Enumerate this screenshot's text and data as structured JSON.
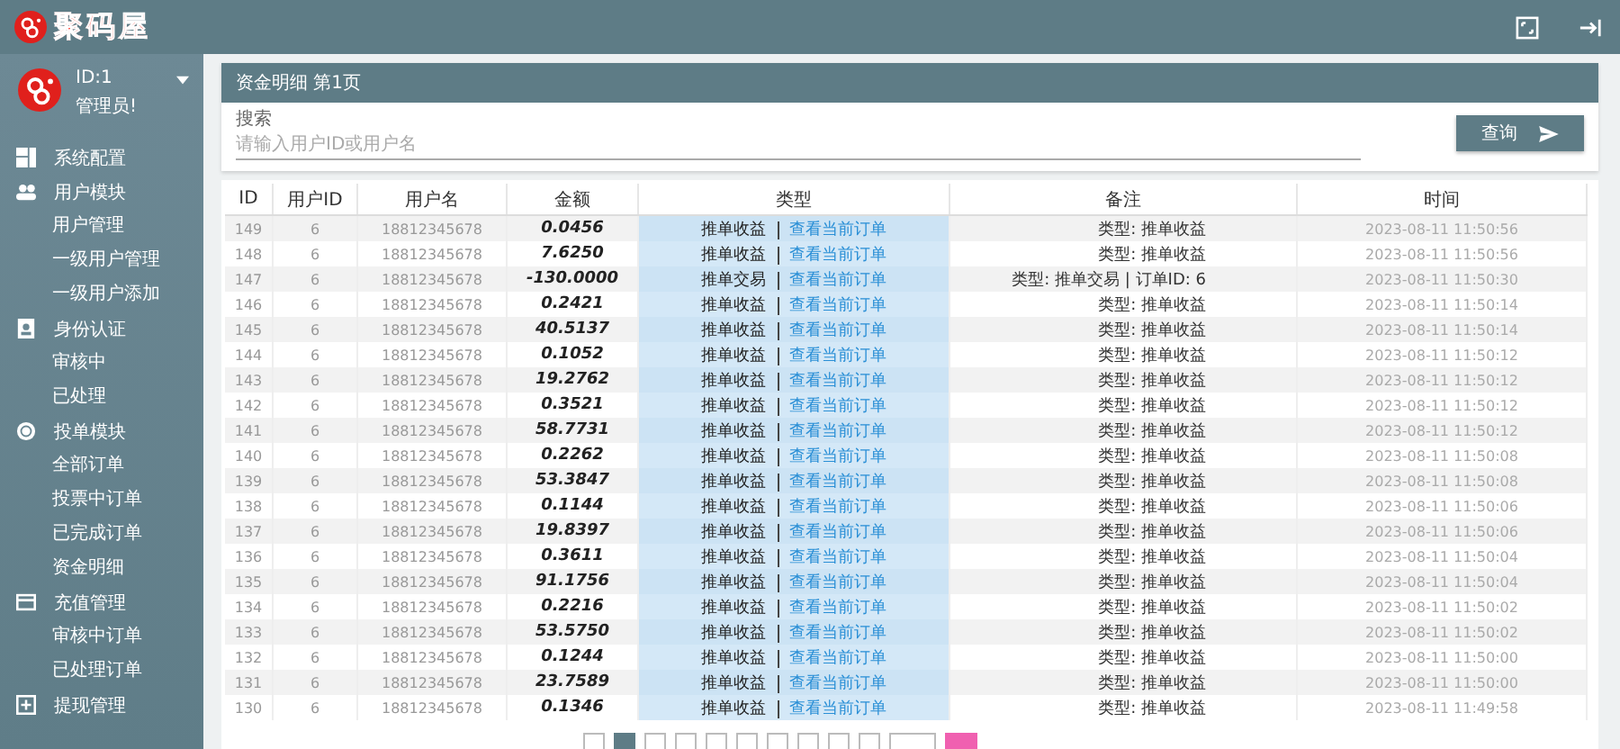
{
  "brand": {
    "logo_text": "聚码屋"
  },
  "user": {
    "id": "ID:1",
    "role": "管理员!"
  },
  "sidebar": {
    "items": [
      {
        "label": "系统配置"
      },
      {
        "label": "用户模块",
        "children": [
          {
            "label": "用户管理"
          },
          {
            "label": "一级用户管理"
          },
          {
            "label": "一级用户添加"
          }
        ]
      },
      {
        "label": "身份认证",
        "children": [
          {
            "label": "审核中"
          },
          {
            "label": "已处理"
          }
        ]
      },
      {
        "label": "投单模块",
        "children": [
          {
            "label": "全部订单"
          },
          {
            "label": "投票中订单"
          },
          {
            "label": "已完成订单"
          },
          {
            "label": "资金明细"
          }
        ]
      },
      {
        "label": "充值管理",
        "children": [
          {
            "label": "审核中订单"
          },
          {
            "label": "已处理订单"
          }
        ]
      },
      {
        "label": "提现管理"
      }
    ]
  },
  "panel": {
    "title": "资金明细 第1页",
    "search": {
      "label": "搜索",
      "placeholder": "请输入用户ID或用户名"
    },
    "query_button": "查询"
  },
  "table": {
    "columns": [
      "ID",
      "用户ID",
      "用户名",
      "金额",
      "类型",
      "备注",
      "时间"
    ],
    "rows": [
      {
        "id": "149",
        "user_id": "6",
        "username": "18812345678",
        "amount": "0.0456",
        "type": {
          "label": "推单收益",
          "link": "查看当前订单"
        },
        "remark": "类型: 推单收益",
        "time": "2023-08-11 11:50:56"
      },
      {
        "id": "148",
        "user_id": "6",
        "username": "18812345678",
        "amount": "7.6250",
        "type": {
          "label": "推单收益",
          "link": "查看当前订单"
        },
        "remark": "类型: 推单收益",
        "time": "2023-08-11 11:50:56"
      },
      {
        "id": "147",
        "user_id": "6",
        "username": "18812345678",
        "amount": "-130.0000",
        "type": {
          "label": "推单交易",
          "link": "查看当前订单"
        },
        "remark": "类型: 推单交易 | 订单ID: 6",
        "time": "2023-08-11 11:50:30"
      },
      {
        "id": "146",
        "user_id": "6",
        "username": "18812345678",
        "amount": "0.2421",
        "type": {
          "label": "推单收益",
          "link": "查看当前订单"
        },
        "remark": "类型: 推单收益",
        "time": "2023-08-11 11:50:14"
      },
      {
        "id": "145",
        "user_id": "6",
        "username": "18812345678",
        "amount": "40.5137",
        "type": {
          "label": "推单收益",
          "link": "查看当前订单"
        },
        "remark": "类型: 推单收益",
        "time": "2023-08-11 11:50:14"
      },
      {
        "id": "144",
        "user_id": "6",
        "username": "18812345678",
        "amount": "0.1052",
        "type": {
          "label": "推单收益",
          "link": "查看当前订单"
        },
        "remark": "类型: 推单收益",
        "time": "2023-08-11 11:50:12"
      },
      {
        "id": "143",
        "user_id": "6",
        "username": "18812345678",
        "amount": "19.2762",
        "type": {
          "label": "推单收益",
          "link": "查看当前订单"
        },
        "remark": "类型: 推单收益",
        "time": "2023-08-11 11:50:12"
      },
      {
        "id": "142",
        "user_id": "6",
        "username": "18812345678",
        "amount": "0.3521",
        "type": {
          "label": "推单收益",
          "link": "查看当前订单"
        },
        "remark": "类型: 推单收益",
        "time": "2023-08-11 11:50:12"
      },
      {
        "id": "141",
        "user_id": "6",
        "username": "18812345678",
        "amount": "58.7731",
        "type": {
          "label": "推单收益",
          "link": "查看当前订单"
        },
        "remark": "类型: 推单收益",
        "time": "2023-08-11 11:50:12"
      },
      {
        "id": "140",
        "user_id": "6",
        "username": "18812345678",
        "amount": "0.2262",
        "type": {
          "label": "推单收益",
          "link": "查看当前订单"
        },
        "remark": "类型: 推单收益",
        "time": "2023-08-11 11:50:08"
      },
      {
        "id": "139",
        "user_id": "6",
        "username": "18812345678",
        "amount": "53.3847",
        "type": {
          "label": "推单收益",
          "link": "查看当前订单"
        },
        "remark": "类型: 推单收益",
        "time": "2023-08-11 11:50:08"
      },
      {
        "id": "138",
        "user_id": "6",
        "username": "18812345678",
        "amount": "0.1144",
        "type": {
          "label": "推单收益",
          "link": "查看当前订单"
        },
        "remark": "类型: 推单收益",
        "time": "2023-08-11 11:50:06"
      },
      {
        "id": "137",
        "user_id": "6",
        "username": "18812345678",
        "amount": "19.8397",
        "type": {
          "label": "推单收益",
          "link": "查看当前订单"
        },
        "remark": "类型: 推单收益",
        "time": "2023-08-11 11:50:06"
      },
      {
        "id": "136",
        "user_id": "6",
        "username": "18812345678",
        "amount": "0.3611",
        "type": {
          "label": "推单收益",
          "link": "查看当前订单"
        },
        "remark": "类型: 推单收益",
        "time": "2023-08-11 11:50:04"
      },
      {
        "id": "135",
        "user_id": "6",
        "username": "18812345678",
        "amount": "91.1756",
        "type": {
          "label": "推单收益",
          "link": "查看当前订单"
        },
        "remark": "类型: 推单收益",
        "time": "2023-08-11 11:50:04"
      },
      {
        "id": "134",
        "user_id": "6",
        "username": "18812345678",
        "amount": "0.2216",
        "type": {
          "label": "推单收益",
          "link": "查看当前订单"
        },
        "remark": "类型: 推单收益",
        "time": "2023-08-11 11:50:02"
      },
      {
        "id": "133",
        "user_id": "6",
        "username": "18812345678",
        "amount": "53.5750",
        "type": {
          "label": "推单收益",
          "link": "查看当前订单"
        },
        "remark": "类型: 推单收益",
        "time": "2023-08-11 11:50:02"
      },
      {
        "id": "132",
        "user_id": "6",
        "username": "18812345678",
        "amount": "0.1244",
        "type": {
          "label": "推单收益",
          "link": "查看当前订单"
        },
        "remark": "类型: 推单收益",
        "time": "2023-08-11 11:50:00"
      },
      {
        "id": "131",
        "user_id": "6",
        "username": "18812345678",
        "amount": "23.7589",
        "type": {
          "label": "推单收益",
          "link": "查看当前订单"
        },
        "remark": "类型: 推单收益",
        "time": "2023-08-11 11:50:00"
      },
      {
        "id": "130",
        "user_id": "6",
        "username": "18812345678",
        "amount": "0.1346",
        "type": {
          "label": "推单收益",
          "link": "查看当前订单"
        },
        "remark": "类型: 推单收益",
        "time": "2023-08-11 11:49:58"
      }
    ]
  },
  "pagination": {
    "pages": [
      {
        "selected": false
      },
      {
        "selected": true
      },
      {
        "selected": false
      },
      {
        "selected": false
      },
      {
        "selected": false
      },
      {
        "selected": false
      },
      {
        "selected": false
      },
      {
        "selected": false
      },
      {
        "selected": false
      },
      {
        "selected": false
      }
    ]
  }
}
